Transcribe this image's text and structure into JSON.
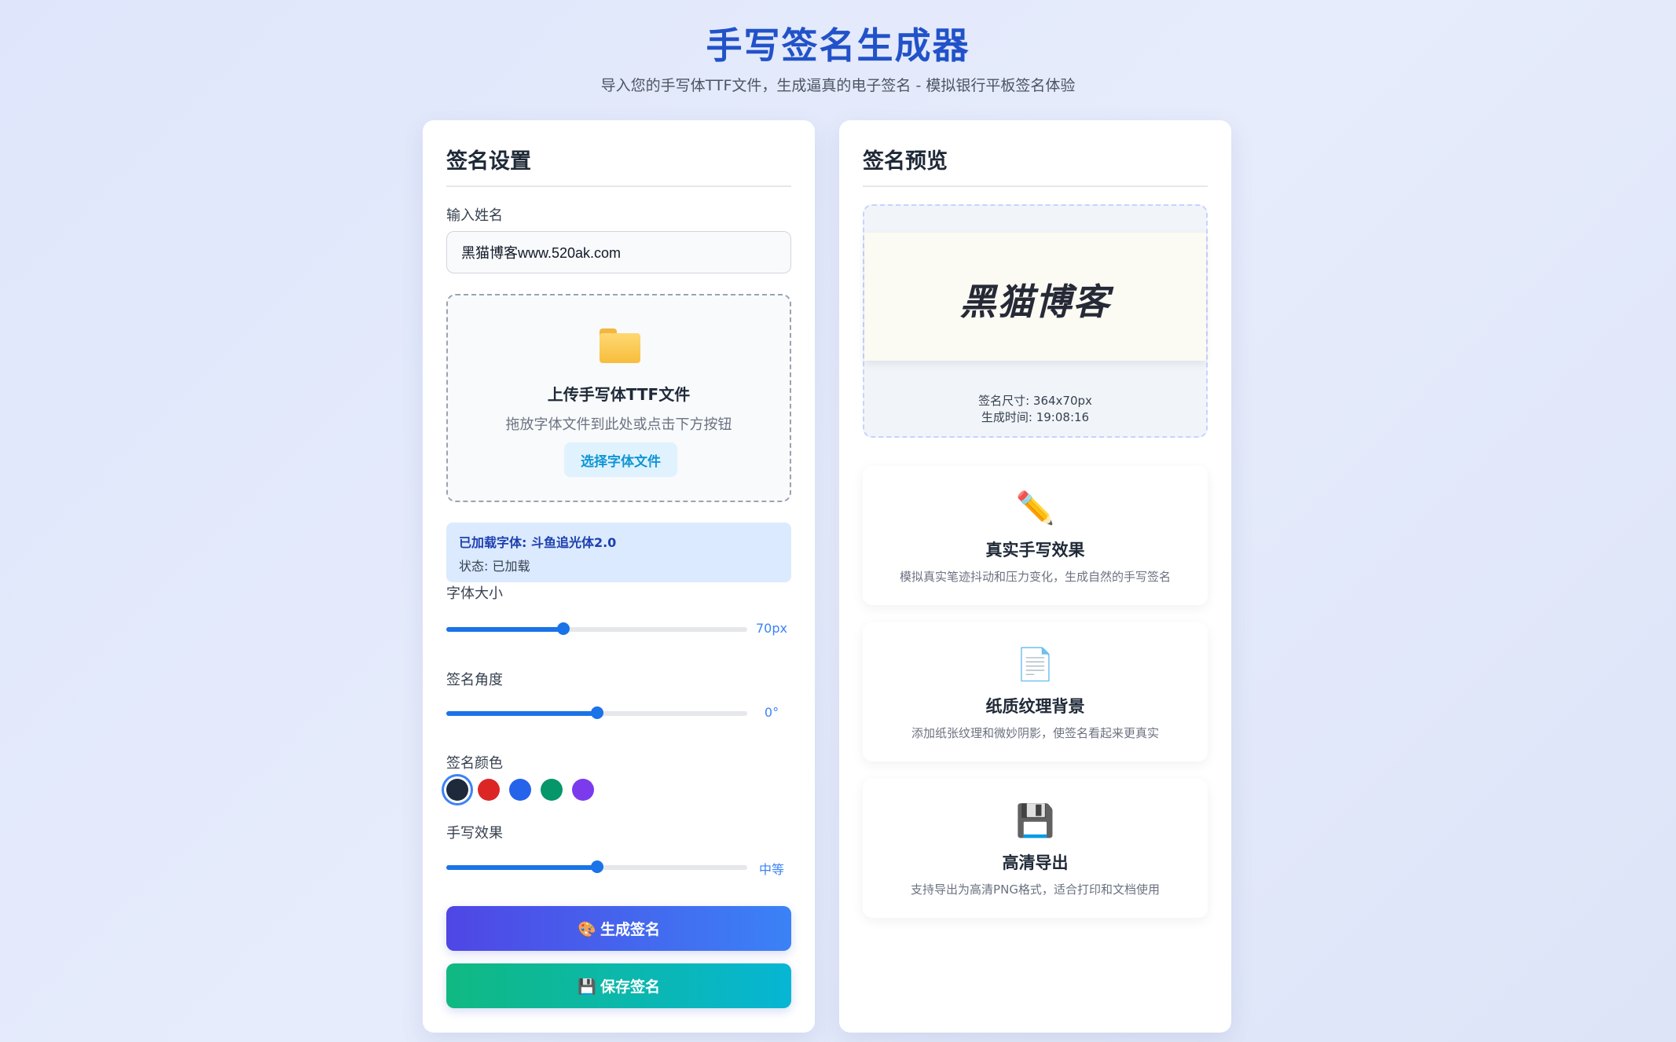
{
  "header": {
    "title": "手写签名生成器",
    "subtitle": "导入您的手写体TTF文件，生成逼真的电子签名 - 模拟银行平板签名体验"
  },
  "settings": {
    "title": "签名设置",
    "name_label": "输入姓名",
    "name_value": "黑猫博客www.520ak.com",
    "upload": {
      "icon": "folder-icon",
      "title": "上传手写体TTF文件",
      "hint": "拖放字体文件到此处或点击下方按钮",
      "button": "选择字体文件"
    },
    "font_info": {
      "loaded": "已加载字体: 斗鱼追光体2.0",
      "status": "状态: 已加载"
    },
    "font_size": {
      "label": "字体大小",
      "value": "70px",
      "fraction": 0.39
    },
    "angle": {
      "label": "签名角度",
      "value": "0°",
      "fraction": 0.5
    },
    "color": {
      "label": "签名颜色",
      "options": [
        "#1e293b",
        "#dc2626",
        "#2563eb",
        "#059669",
        "#7c3aed"
      ],
      "selected": "#1e293b"
    },
    "effect": {
      "label": "手写效果",
      "value": "中等",
      "fraction": 0.5
    },
    "generate_button": "🎨 生成签名",
    "save_button": "💾 保存签名"
  },
  "preview": {
    "title": "签名预览",
    "signature_text": "黑猫博客",
    "size": "签名尺寸: 364x70px",
    "time": "生成时间: 19:08:16"
  },
  "features": [
    {
      "icon": "pencil-icon",
      "glyph": "✏️",
      "title": "真实手写效果",
      "desc": "模拟真实笔迹抖动和压力变化，生成自然的手写签名"
    },
    {
      "icon": "document-icon",
      "glyph": "📄",
      "title": "纸质纹理背景",
      "desc": "添加纸张纹理和微妙阴影，使签名看起来更真实"
    },
    {
      "icon": "floppy-disk-icon",
      "glyph": "💾",
      "title": "高清导出",
      "desc": "支持导出为高清PNG格式，适合打印和文档使用"
    }
  ],
  "colors": {
    "accent": "#2252c9",
    "slider": "#1a73e8"
  }
}
